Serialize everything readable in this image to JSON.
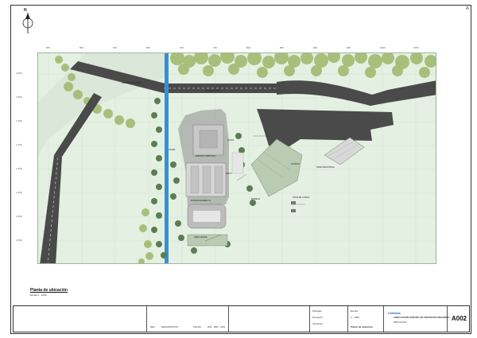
{
  "sheet": {
    "north_label": "N",
    "corner_mark": "A",
    "sheet_number": "A002"
  },
  "plan": {
    "title": "Planta de ubicación",
    "scale": "Escala 1 : 1000",
    "labels": [
      {
        "text": "AVENIDA PRINCIPAL"
      },
      {
        "text": "VÍA DE ACCESO"
      },
      {
        "text": "EDIFICIO PRINCIPAL"
      },
      {
        "text": "ESTACIONAMIENTO"
      },
      {
        "text": "ÁREA VERDE"
      },
      {
        "text": "BODEGA"
      },
      {
        "text": "ACCESO"
      },
      {
        "text": "ZONA DE CARGA"
      },
      {
        "text": "PLAZA"
      },
      {
        "text": "CANAL"
      },
      {
        "text": "NAVE INDUSTRIAL"
      },
      {
        "text": "PATIO"
      }
    ],
    "grid_ticks_left": [
      "1.000",
      "1.050",
      "1.100",
      "1.150",
      "1.200",
      "1.250",
      "1.300",
      "1.350"
    ],
    "grid_ticks_top": [
      "500",
      "550",
      "600",
      "650",
      "700",
      "750",
      "800",
      "850",
      "900",
      "950",
      "1000",
      "1050"
    ]
  },
  "title_block": {
    "project_title": "AMPLIACIÓN CENTRO DE SERVICIOS REGIONAL",
    "project_subtitle": "UBICACIÓN",
    "sheet_title": "Planta de ubicación",
    "logo": "Cetimsa",
    "revision_header": [
      "REV",
      "DESCRIPCIÓN",
      "FECHA",
      "DIB",
      "REV",
      "APR"
    ],
    "drawn_by": "Dibujado",
    "checked_by": "Revisado",
    "approved_by": "Aprobado",
    "scale_label": "Escala",
    "scale_value": "1 : 1000"
  },
  "colors": {
    "road": "#4a4a4a",
    "grass": "#e4f0e2",
    "tree_light": "#a7bf7a",
    "tree_dark": "#5c7d52",
    "water": "#3a8fd0",
    "building_roof": "#c8c8c8",
    "structure": "#b9cbb3"
  }
}
